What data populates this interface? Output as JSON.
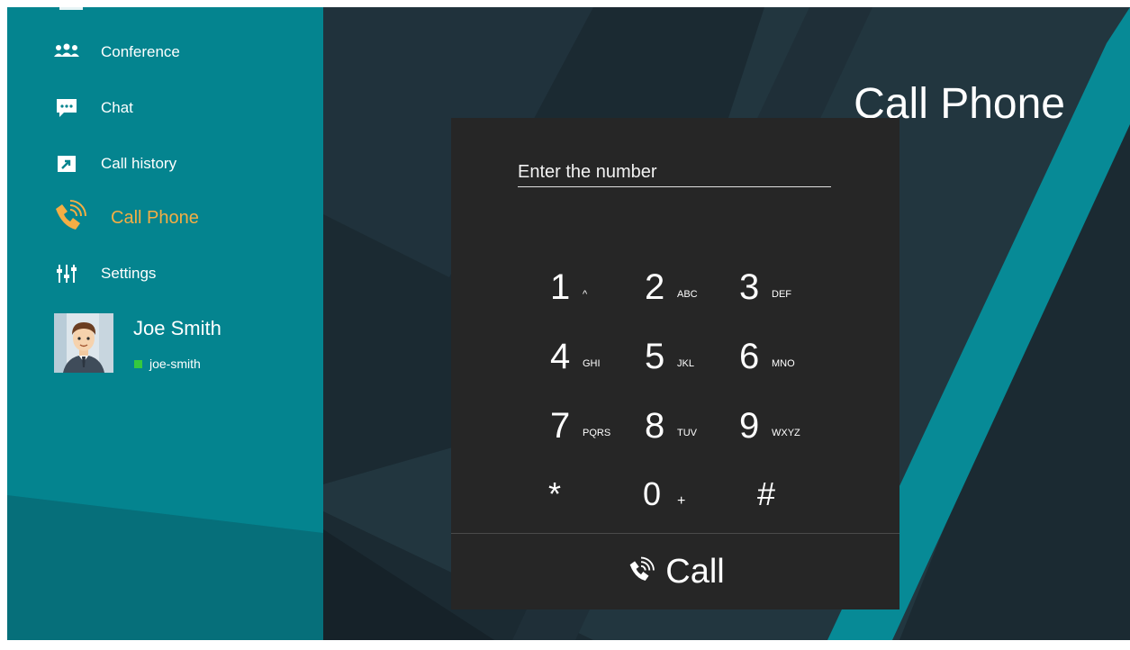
{
  "page": {
    "title": "Call Phone"
  },
  "sidebar": {
    "items": [
      {
        "id": "conference",
        "label": "Conference",
        "icon": "conference-icon",
        "active": false
      },
      {
        "id": "chat",
        "label": "Chat",
        "icon": "chat-icon",
        "active": false
      },
      {
        "id": "call-history",
        "label": "Call history",
        "icon": "call-history-icon",
        "active": false
      },
      {
        "id": "call-phone",
        "label": "Call Phone",
        "icon": "phone-ringing-icon",
        "active": true
      },
      {
        "id": "settings",
        "label": "Settings",
        "icon": "settings-sliders-icon",
        "active": false
      }
    ]
  },
  "profile": {
    "name": "Joe Smith",
    "handle": "joe-smith",
    "status": "online",
    "status_color": "#35c93f"
  },
  "dialer": {
    "input_placeholder": "Enter the number",
    "input_value": "",
    "keys": [
      {
        "digit": "1",
        "letters": "^"
      },
      {
        "digit": "2",
        "letters": "ABC"
      },
      {
        "digit": "3",
        "letters": "DEF"
      },
      {
        "digit": "4",
        "letters": "GHI"
      },
      {
        "digit": "5",
        "letters": "JKL"
      },
      {
        "digit": "6",
        "letters": "MNO"
      },
      {
        "digit": "7",
        "letters": "PQRS"
      },
      {
        "digit": "8",
        "letters": "TUV"
      },
      {
        "digit": "9",
        "letters": "WXYZ"
      },
      {
        "digit": "*",
        "letters": ""
      },
      {
        "digit": "0",
        "letters": "+"
      },
      {
        "digit": "#",
        "letters": ""
      }
    ],
    "call_label": "Call"
  },
  "colors": {
    "sidebar_bg": "#04848f",
    "main_bg": "#1e2a33",
    "active_accent": "#f4ae45",
    "dialer_bg": "#262626"
  }
}
